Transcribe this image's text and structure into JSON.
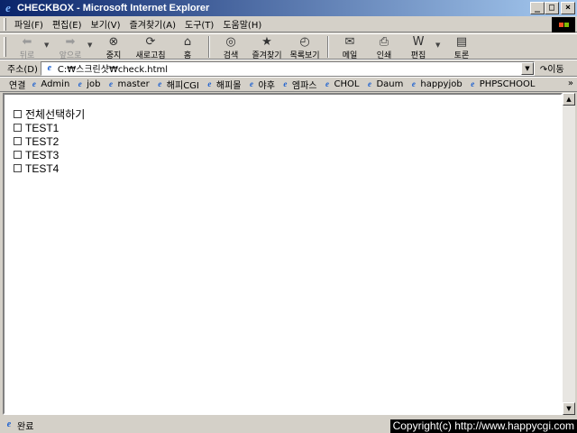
{
  "window": {
    "title": "CHECKBOX - Microsoft Internet Explorer",
    "buttons": {
      "minimize": "_",
      "maximize": "□",
      "close": "×"
    }
  },
  "menu": [
    "파일(F)",
    "편집(E)",
    "보기(V)",
    "즐겨찾기(A)",
    "도구(T)",
    "도움말(H)"
  ],
  "toolbar": [
    {
      "label": "뒤로",
      "icon": "back-arrow-icon",
      "glyph": "⬅",
      "enabled": false
    },
    {
      "label": "앞으로",
      "icon": "forward-arrow-icon",
      "glyph": "➡",
      "enabled": false
    },
    {
      "label": "중지",
      "icon": "stop-icon",
      "glyph": "⊗",
      "enabled": true
    },
    {
      "label": "새로고침",
      "icon": "refresh-icon",
      "glyph": "⟳",
      "enabled": true
    },
    {
      "label": "홈",
      "icon": "home-icon",
      "glyph": "⌂",
      "enabled": true
    },
    {
      "label": "검색",
      "icon": "search-icon",
      "glyph": "◎",
      "enabled": true
    },
    {
      "label": "즐겨찾기",
      "icon": "favorites-icon",
      "glyph": "★",
      "enabled": true
    },
    {
      "label": "목록보기",
      "icon": "history-icon",
      "glyph": "◴",
      "enabled": true
    },
    {
      "label": "메일",
      "icon": "mail-icon",
      "glyph": "✉",
      "enabled": true
    },
    {
      "label": "인쇄",
      "icon": "print-icon",
      "glyph": "⎙",
      "enabled": true
    },
    {
      "label": "편집",
      "icon": "edit-icon",
      "glyph": "W",
      "enabled": true
    },
    {
      "label": "토론",
      "icon": "discuss-icon",
      "glyph": "▤",
      "enabled": true
    }
  ],
  "address": {
    "label": "주소(D)",
    "value": "C:₩스크린샷₩check.html",
    "go_label": "이동"
  },
  "links": {
    "label": "연결",
    "items": [
      "Admin",
      "job",
      "master",
      "해피CGI",
      "해피몰",
      "야후",
      "엠파스",
      "CHOL",
      "Daum",
      "happyjob",
      "PHPSCHOOL"
    ],
    "more": "»"
  },
  "checkboxes": [
    {
      "label": "전체선택하기",
      "checked": false
    },
    {
      "label": "TEST1",
      "checked": false
    },
    {
      "label": "TEST2",
      "checked": false
    },
    {
      "label": "TEST3",
      "checked": false
    },
    {
      "label": "TEST4",
      "checked": false
    }
  ],
  "status": {
    "text": "완료",
    "copyright": "Copyright(c) http://www.happycgi.com"
  }
}
